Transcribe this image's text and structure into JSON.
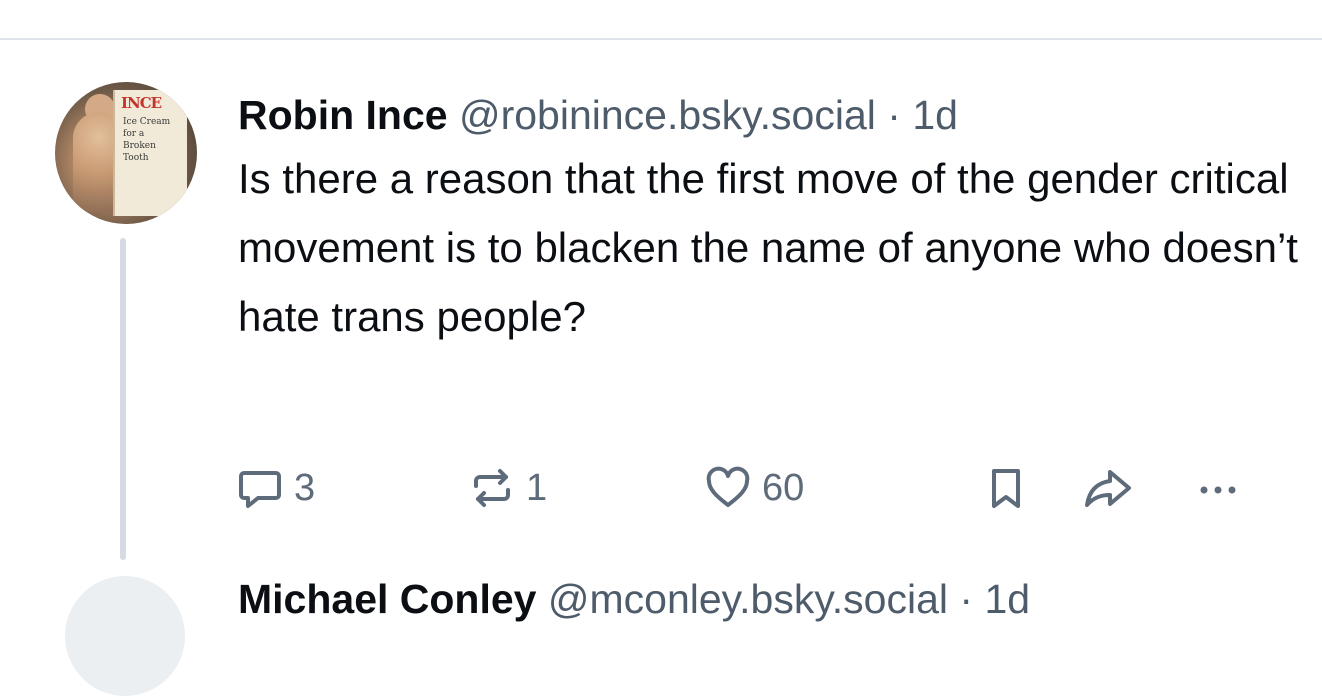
{
  "post": {
    "author_name": "Robin Ince",
    "handle": "@robinince.bsky.social",
    "separator": "·",
    "time_ago": "1d",
    "text": "Is there a reason that the first move of the gender critical movement is to blacken the name of anyone who doesn’t hate trans people?",
    "avatar": {
      "brand": "INCE",
      "book_text": "Ice Cream for a Broken Tooth"
    },
    "actions": {
      "reply_icon": "reply-icon",
      "reply_count": "3",
      "repost_icon": "repost-icon",
      "repost_count": "1",
      "like_icon": "heart-icon",
      "like_count": "60",
      "bookmark_icon": "bookmark-icon",
      "share_icon": "share-icon",
      "more_icon": "more-icon"
    }
  },
  "next_post": {
    "author_name": "Michael Conley",
    "handle": "@mconley.bsky.social",
    "separator": "·",
    "time_ago": "1d"
  },
  "colors": {
    "text": "#0b0f14",
    "secondary": "#4d5b6a",
    "icon": "#5e6b7a",
    "divider": "#dfe4ea"
  }
}
